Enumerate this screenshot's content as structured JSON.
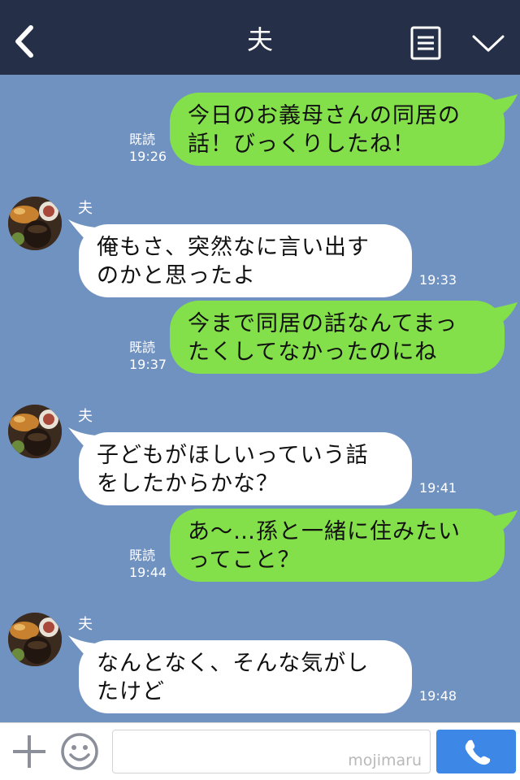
{
  "header": {
    "title": "夫",
    "back_icon": "chevron-left-icon",
    "menu_icon": "menu-list-icon",
    "collapse_icon": "chevron-down-icon",
    "bg_color": "#262f48"
  },
  "chat": {
    "bg_color": "#7092c0",
    "outgoing_color": "#84e04a",
    "incoming_color": "#ffffff",
    "messages": [
      {
        "direction": "out",
        "lines": [
          "今日のお義母さんの同居の",
          "話！びっくりしたね！"
        ],
        "read": "既読",
        "time": "19:26"
      },
      {
        "direction": "in",
        "sender": "夫",
        "lines": [
          "俺もさ、突然なに言い出す",
          "のかと思ったよ"
        ],
        "time": "19:33"
      },
      {
        "direction": "out",
        "lines": [
          "今まで同居の話なんてまっ",
          "たくしてなかったのにね"
        ],
        "read": "既読",
        "time": "19:37"
      },
      {
        "direction": "in",
        "sender": "夫",
        "lines": [
          "子どもがほしいっていう話",
          "をしたからかな？"
        ],
        "time": "19:41"
      },
      {
        "direction": "out",
        "lines": [
          "あ～…孫と一緒に住みたい",
          "ってこと？"
        ],
        "read": "既読",
        "time": "19:44"
      },
      {
        "direction": "in",
        "sender": "夫",
        "lines": [
          "なんとなく、そんな気がし",
          "たけど"
        ],
        "time": "19:48"
      }
    ]
  },
  "inputbar": {
    "plus_icon": "plus-icon",
    "sticker_icon": "smiley-icon",
    "watermark": "mojimaru",
    "call_icon": "phone-icon",
    "call_color": "#3d87e6"
  }
}
